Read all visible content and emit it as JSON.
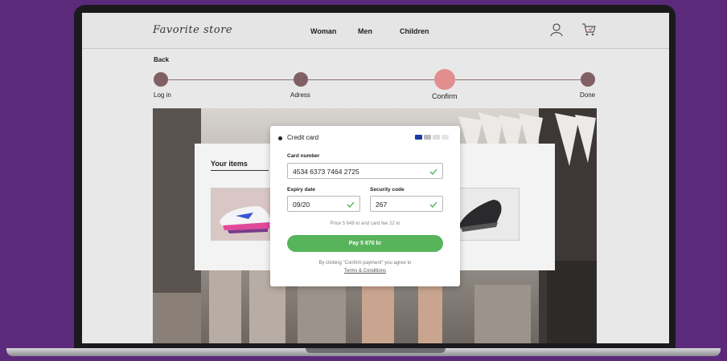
{
  "header": {
    "logo": "Favorite store",
    "nav": [
      "Woman",
      "Men",
      "Children"
    ]
  },
  "back_label": "Back",
  "steps": [
    "Log in",
    "Adress",
    "Confirm",
    "Done"
  ],
  "active_step": "Confirm",
  "items": {
    "title": "Your items"
  },
  "payment": {
    "method_label": "Credit card",
    "card_number_label": "Card number",
    "card_number_value": "4534 6373 7464 2725",
    "expiry_label": "Expiry date",
    "expiry_value": "09/20",
    "security_label": "Security code",
    "security_value": "267",
    "price_note": "Price 5 648 kr and card fee 22 kr",
    "pay_label": "Pay 5 670 kr",
    "terms_note": "By clicking \"Confirm payment\" you agree to",
    "terms_link": "Terms & Conditions"
  },
  "colors": {
    "background": "#5b2a7a",
    "step_dot": "#806064",
    "step_active": "#e08f8e",
    "pay_button": "#57b45a",
    "check": "#4caf50"
  }
}
